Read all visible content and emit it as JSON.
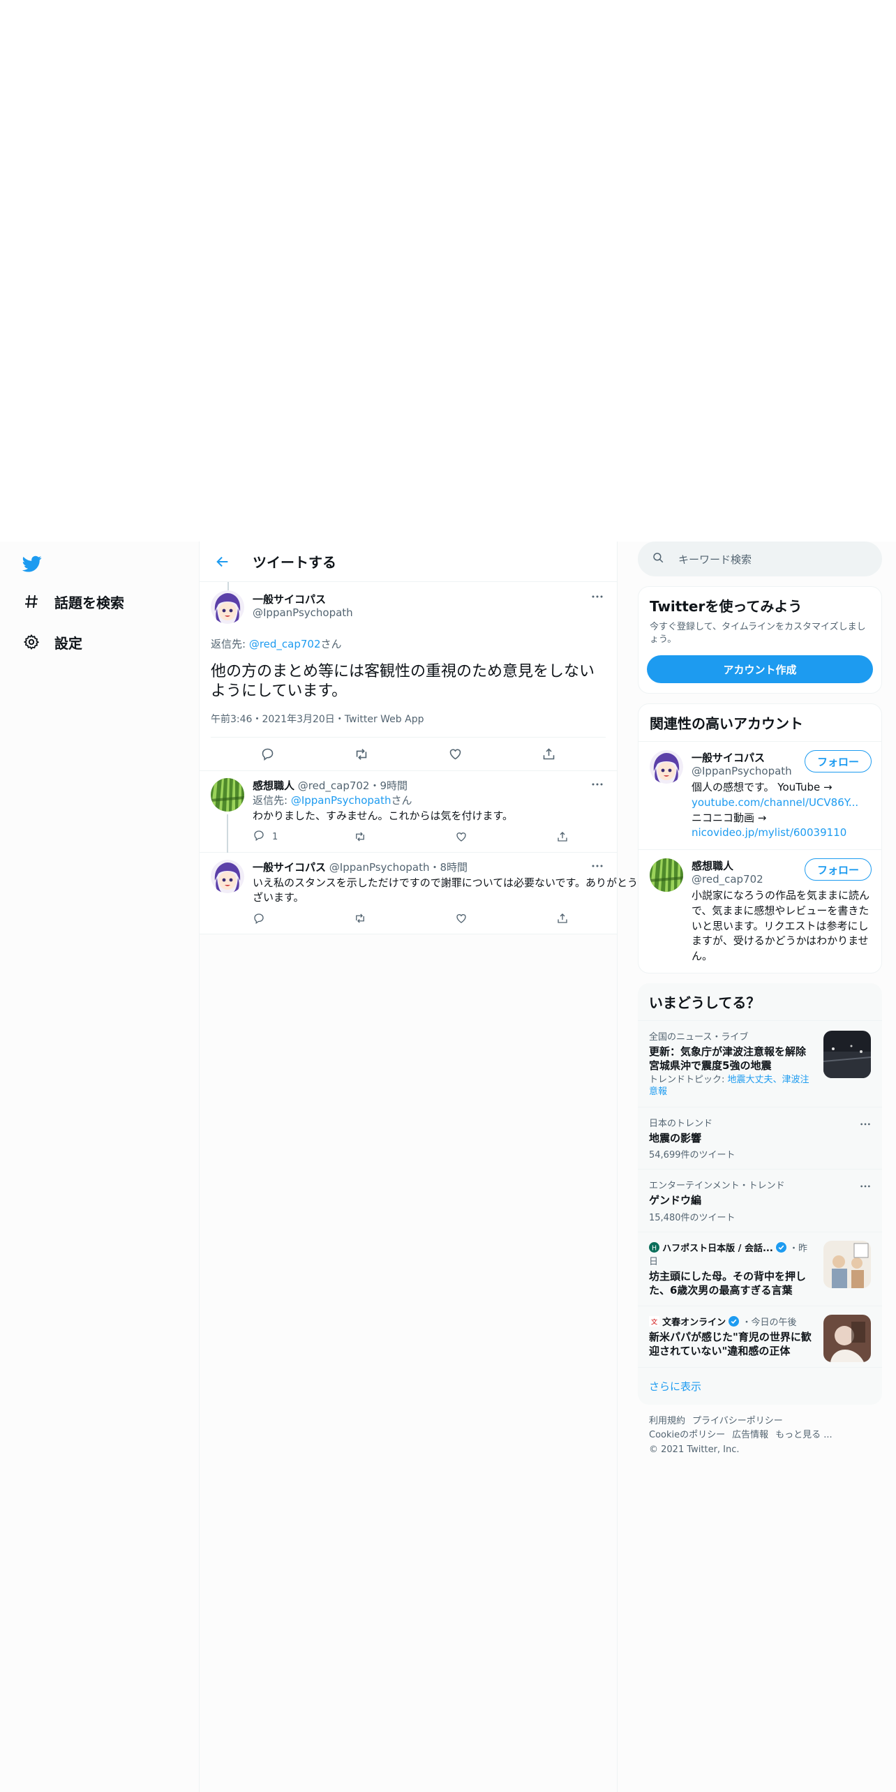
{
  "nav": {
    "items": [
      {
        "label": "話題を検索"
      },
      {
        "label": "設定"
      }
    ]
  },
  "header": {
    "title": "ツイートする"
  },
  "focus_tweet": {
    "name": "一般サイコパス",
    "handle": "@IppanPsychopath",
    "reply_prefix": "返信先: ",
    "reply_handle": "@red_cap702",
    "reply_suffix": "さん",
    "text": "他の方のまとめ等には客観性の重視のため意見をしないようにしています。",
    "meta": "午前3:46・2021年3月20日・Twitter Web App"
  },
  "replies": [
    {
      "name": "感想職人",
      "handle": "@red_cap702",
      "time": "・9時間",
      "reply_prefix": "返信先: ",
      "reply_handle": "@IppanPsychopath",
      "reply_suffix": "さん",
      "text": "わかりました、すみません。これからは気を付けます。",
      "reply_count": "1"
    },
    {
      "name": "一般サイコパス",
      "handle": "@IppanPsychopath",
      "time": "・8時間",
      "text": "いえ私のスタンスを示しただけですので謝罪については必要ないです。ありがとうございます。"
    }
  ],
  "search": {
    "placeholder": "キーワード検索"
  },
  "signup_card": {
    "title": "Twitterを使ってみよう",
    "subtitle": "今すぐ登録して、タイムラインをカスタマイズしましょう。",
    "button": "アカウント作成"
  },
  "related": {
    "title": "関連性の高いアカウント",
    "follow_label": "フォロー",
    "accounts": [
      {
        "name": "一般サイコパス",
        "handle": "@IppanPsychopath",
        "bio_1": "個人の感想です。 YouTube → ",
        "bio_link_1": "youtube.com/channel/UCV86Y...",
        "bio_2": " ニコニコ動画 → ",
        "bio_link_2": "nicovideo.jp/mylist/60039110"
      },
      {
        "name": "感想職人",
        "handle": "@red_cap702",
        "bio": "小説家になろうの作品を気ままに読んで、気ままに感想やレビューを書きたいと思います。リクエストは参考にしますが、受けるかどうかはわかりません。"
      }
    ]
  },
  "trends": {
    "title": "いまどうしてる？",
    "items": [
      {
        "category": "全国のニュース・ライブ",
        "name": "更新：気象庁が津波注意報を解除 宮城県沖で震度5強の地震",
        "topic_prefix": "トレンドトピック: ",
        "topic_links": "地震大丈夫、津波注意報"
      },
      {
        "category": "日本のトレンド",
        "name": "地震の影響",
        "count": "54,699件のツイート"
      },
      {
        "category": "エンターテインメント・トレンド",
        "name": "ゲンドウ編",
        "count": "15,480件のツイート"
      },
      {
        "source": "ハフポスト日本版 / 会話...",
        "time": "・昨日",
        "name": "坊主頭にした母。その背中を押した、6歳次男の最高すぎる言葉"
      },
      {
        "source": "文春オンライン",
        "time": "・今日の午後",
        "name": "新米パパが感じた\"育児の世界に歓迎されていない\"違和感の正体"
      }
    ],
    "show_more": "さらに表示"
  },
  "footer": {
    "links": [
      "利用規約",
      "プライバシーポリシー",
      "Cookieのポリシー",
      "広告情報",
      "もっと見る ..."
    ],
    "copyright": "© 2021 Twitter, Inc."
  },
  "colors": {
    "accent": "#1d9bf0",
    "text": "#0f1419",
    "secondary": "#536471",
    "border": "#eff3f4"
  }
}
